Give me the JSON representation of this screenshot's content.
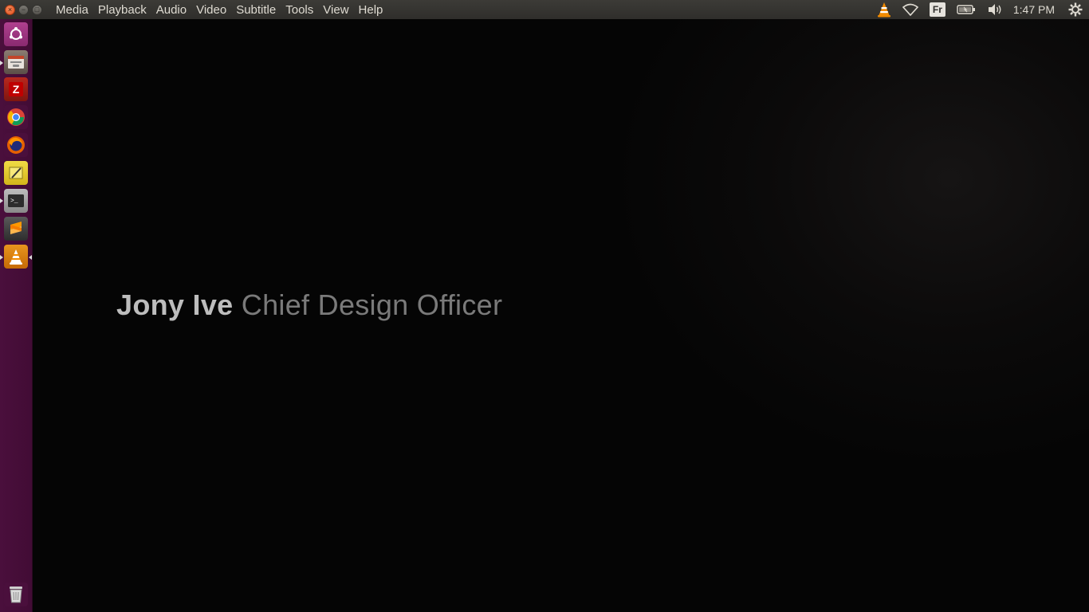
{
  "app": {
    "name": "VLC media player"
  },
  "window_controls": {
    "close": "×",
    "minimize": "−",
    "maximize": "□"
  },
  "menu": [
    "Media",
    "Playback",
    "Audio",
    "Video",
    "Subtitle",
    "Tools",
    "View",
    "Help"
  ],
  "indicators": {
    "keyboard_layout": "Fr",
    "clock": "1:47 PM"
  },
  "launcher": {
    "items": [
      "ubuntu-dash",
      "files",
      "filezilla",
      "chrome",
      "firefox",
      "text-editor",
      "terminal",
      "sublime-text",
      "vlc"
    ],
    "trash": "trash"
  },
  "video": {
    "caption_name": "Jony Ive",
    "caption_role": "Chief Design Officer"
  },
  "colors": {
    "launcher_bg": "#4a0f3c",
    "panel_bg": "#3c3b37",
    "close_button": "#e0501d"
  }
}
